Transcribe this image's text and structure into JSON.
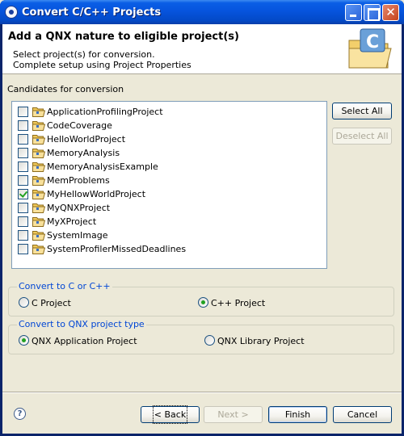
{
  "window": {
    "title": "Convert C/C++ Projects"
  },
  "header": {
    "title": "Add a QNX nature to eligible project(s)",
    "desc_line1": "Select project(s) for conversion.",
    "desc_line2": "Complete setup using Project Properties"
  },
  "candidates": {
    "label": "Candidates for conversion",
    "items": [
      {
        "label": "ApplicationProfilingProject",
        "checked": false
      },
      {
        "label": "CodeCoverage",
        "checked": false
      },
      {
        "label": "HelloWorldProject",
        "checked": false
      },
      {
        "label": "MemoryAnalysis",
        "checked": false
      },
      {
        "label": "MemoryAnalysisExample",
        "checked": false
      },
      {
        "label": "MemProblems",
        "checked": false
      },
      {
        "label": "MyHellowWorldProject",
        "checked": true
      },
      {
        "label": "MyQNXProject",
        "checked": false
      },
      {
        "label": "MyXProject",
        "checked": false
      },
      {
        "label": "SystemImage",
        "checked": false
      },
      {
        "label": "SystemProfilerMissedDeadlines",
        "checked": false
      }
    ],
    "select_all": "Select All",
    "deselect_all": "Deselect All"
  },
  "convert_lang": {
    "label": "Convert to C or C++",
    "option_c": "C Project",
    "option_cpp": "C++ Project",
    "selected": "cpp"
  },
  "project_type": {
    "label": "Convert to QNX project type",
    "option_app": "QNX Application Project",
    "option_lib": "QNX Library Project",
    "selected": "app"
  },
  "footer": {
    "help_glyph": "?",
    "back_label": "< Back",
    "next_label": "Next >",
    "finish_label": "Finish",
    "cancel_label": "Cancel"
  },
  "colors": {
    "titlebar": "#0654dd",
    "group_label": "#0046d5",
    "check": "#21a121"
  }
}
